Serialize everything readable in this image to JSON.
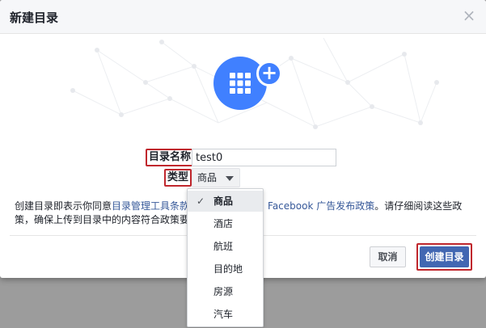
{
  "dialog": {
    "title": "新建目录",
    "close_icon": "close-icon"
  },
  "icon": {
    "name": "catalog-grid-icon",
    "badge": "+",
    "color": "#4080ff"
  },
  "form": {
    "name_label": "目录名称",
    "name_value": "test0",
    "type_label": "类型",
    "type_value": "商品"
  },
  "policy": {
    "text_1": "创建目录即表示你同意",
    "link_1": "目录管理工具条款",
    "link_2": "Facebook 广告发布政策",
    "text_2": "。请仔细阅读这些政",
    "text_3": "策，确保上传到目录中的内容符合政策要"
  },
  "dropdown": {
    "items": [
      {
        "label": "商品",
        "selected": true
      },
      {
        "label": "酒店",
        "selected": false
      },
      {
        "label": "航班",
        "selected": false
      },
      {
        "label": "目的地",
        "selected": false
      },
      {
        "label": "房源",
        "selected": false
      },
      {
        "label": "汽车",
        "selected": false
      }
    ],
    "check": "✓"
  },
  "buttons": {
    "cancel": "取消",
    "create": "创建目录"
  },
  "colors": {
    "accent": "#4267b2",
    "highlight": "#c0272d",
    "link": "#365899"
  }
}
